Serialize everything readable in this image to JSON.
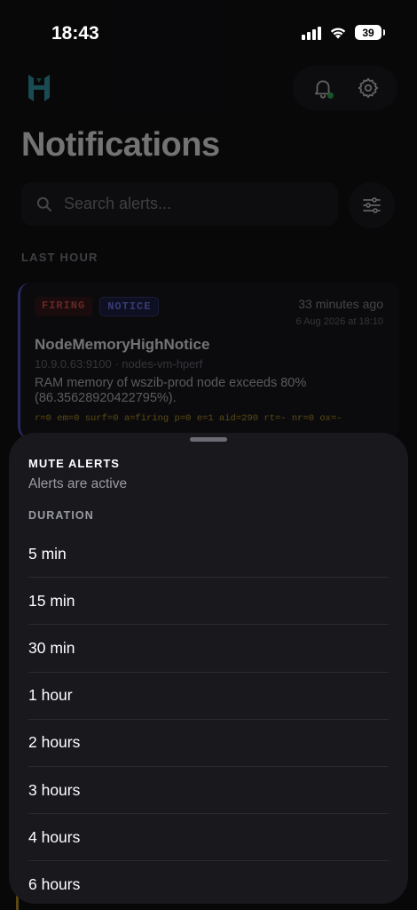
{
  "status_bar": {
    "time": "18:43",
    "battery": "39"
  },
  "header": {
    "title": "Notifications",
    "search_placeholder": "Search alerts..."
  },
  "section": {
    "label": "LAST HOUR"
  },
  "alert": {
    "badge_state": "FIRING",
    "badge_severity": "NOTICE",
    "relative_time": "33 minutes ago",
    "date": "6 Aug 2026 at 18:10",
    "title": "NodeMemoryHighNotice",
    "source": "10.9.0.63:9100 · nodes-vm-hperf",
    "description": "RAM memory of wszib-prod node exceeds 80% (86.35628920422795%).",
    "meta": "r=0 em=0 surf=0 a=firing p=0 e=1 aid=290 rt=- nr=0 ox=-"
  },
  "sheet": {
    "title": "MUTE ALERTS",
    "subtitle": "Alerts are active",
    "duration_label": "DURATION",
    "options": [
      "5 min",
      "15 min",
      "30 min",
      "1 hour",
      "2 hours",
      "3 hours",
      "4 hours",
      "6 hours"
    ]
  },
  "colors": {
    "accent_green": "#2fbf5b",
    "logo_teal": "#3aa7b8",
    "firing_red": "#e05656",
    "notice_blue": "#7a82ff",
    "meta_yellow": "#c9a227"
  }
}
